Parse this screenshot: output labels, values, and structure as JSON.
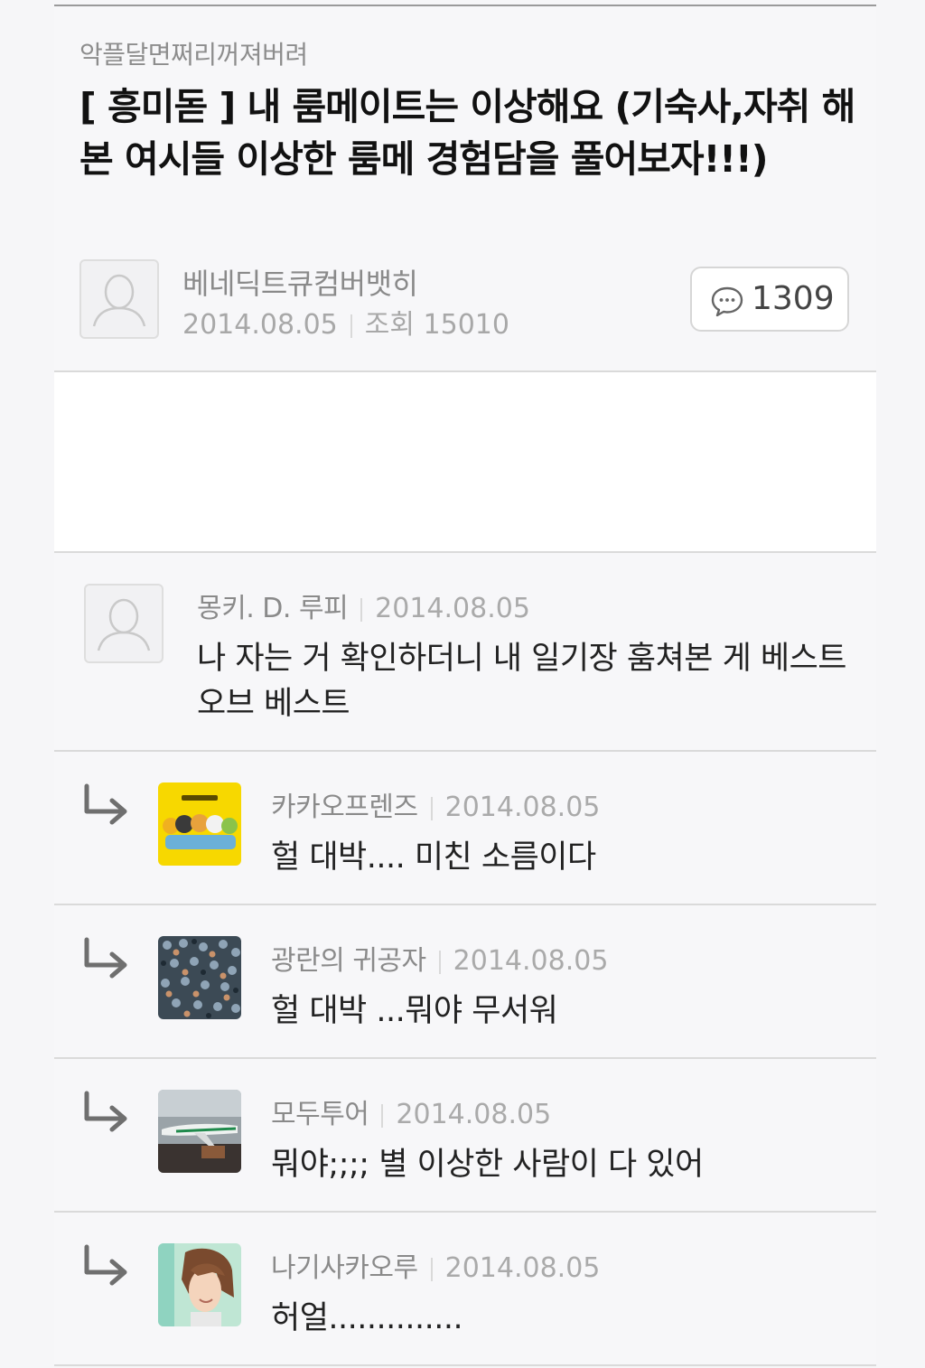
{
  "post": {
    "board": "악플달면쩌리꺼져버려",
    "title": "[ 흥미돋 ] 내 룸메이트는 이상해요 (기숙사,자취 해본 여시들 이상한 룸메 경험담을 풀어보자!!!)",
    "author": "베네딕트큐컴버뱃히",
    "date": "2014.08.05",
    "views_label": "조회",
    "views": "15010",
    "comment_count": "1309"
  },
  "comments": [
    {
      "name": "몽키. D. 루피",
      "date": "2014.08.05",
      "text": "나 자는 거 확인하더니 내 일기장 훔쳐본 게 베스트 오브 베스트",
      "avatar": "default-user-icon",
      "reply": false
    },
    {
      "name": "카카오프렌즈",
      "date": "2014.08.05",
      "text": "헐 대박.... 미친 소름이다",
      "avatar": "kakao-friends-thumbnail",
      "reply": true
    },
    {
      "name": "광란의 귀공자",
      "date": "2014.08.05",
      "text": "헐 대박 ...뭐야 무서워",
      "avatar": "crowd-photo-thumbnail",
      "reply": true
    },
    {
      "name": "모두투어",
      "date": "2014.08.05",
      "text": "뭐야;;;; 별 이상한 사람이 다 있어",
      "avatar": "airplane-photo-thumbnail",
      "reply": true
    },
    {
      "name": "나기사카오루",
      "date": "2014.08.05",
      "text": "허얼..............",
      "avatar": "anime-character-thumbnail",
      "reply": true
    }
  ],
  "colors": {
    "background": "#f7f7f9",
    "divider": "#dadada",
    "meta_text": "#aaaaaa",
    "kakao_yellow": "#f7d800"
  }
}
